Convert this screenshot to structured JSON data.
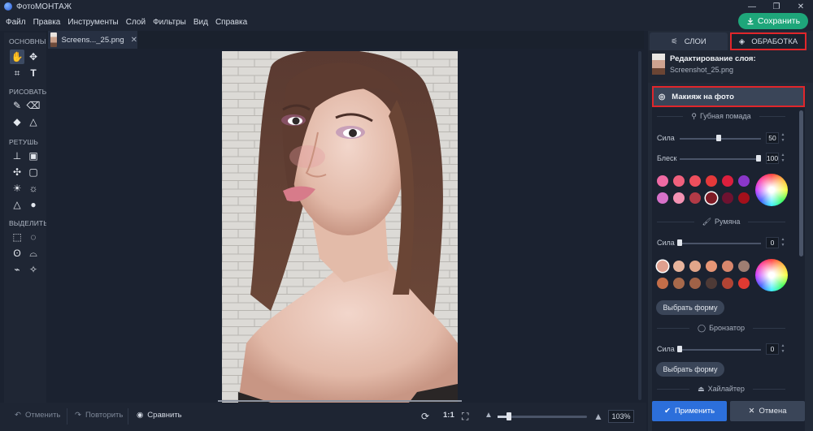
{
  "window": {
    "title": "ФотоМОНТАЖ",
    "controls": [
      "—",
      "❐",
      "✕"
    ]
  },
  "menu": {
    "items": [
      "Файл",
      "Правка",
      "Инструменты",
      "Слой",
      "Фильтры",
      "Вид",
      "Справка"
    ],
    "save_label": "Сохранить"
  },
  "toolbar": {
    "sections": [
      "ОСНОВНЫЕ",
      "РИСОВАТЬ",
      "РЕТУШЬ",
      "ВЫДЕЛИТЬ"
    ]
  },
  "document": {
    "tab_name": "Screens..._25.png",
    "tab_close": "✕"
  },
  "bottom": {
    "undo": "Отменить",
    "redo": "Повторить",
    "compare": "Сравнить",
    "one_to_one": "1:1",
    "zoom": "103%",
    "zoom_fraction": 0.13
  },
  "right_panel": {
    "tabs": {
      "layers": "СЛОИ",
      "processing": "ОБРАБОТКА"
    },
    "layer": {
      "title": "Редактирование слоя:",
      "filename": "Screenshot_25.png"
    },
    "makeup_button": "Макияж на фото",
    "lipstick": {
      "title": "Губная помада",
      "strength_label": "Сила",
      "strength_value": "50",
      "gloss_label": "Блеск",
      "gloss_value": "100",
      "colors_row1": [
        "#ef6aa4",
        "#f0607d",
        "#ee4f5d",
        "#e5393a",
        "#dc1f3d",
        "#8a37c9"
      ],
      "colors_row2": [
        "#d771c9",
        "#f392b3",
        "#b33a46",
        "#7e1a25",
        "#6e1230",
        "#a4101b"
      ],
      "selected_index_row2": 3
    },
    "blush": {
      "title": "Румяна",
      "strength_label": "Сила",
      "strength_value": "0",
      "colors_row1": [
        "#dfa08f",
        "#e8b49c",
        "#e2a68a",
        "#e69676",
        "#d8876d",
        "#9e7e72"
      ],
      "colors_row2": [
        "#c46e49",
        "#a7694b",
        "#a06247",
        "#4e3a36",
        "#b14434",
        "#e03a32"
      ],
      "selected_index_row1": 0,
      "shape_button": "Выбрать форму"
    },
    "bronzer": {
      "title": "Бронзатор",
      "strength_label": "Сила",
      "strength_value": "0",
      "shape_button": "Выбрать форму"
    },
    "highlighter": {
      "title": "Хайлайтер"
    },
    "apply_label": "Применить",
    "cancel_label": "Отмена"
  }
}
